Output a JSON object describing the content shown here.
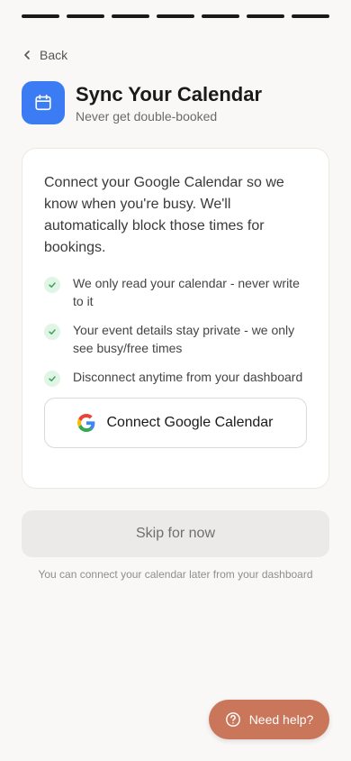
{
  "progress": {
    "total_steps": 7,
    "completed_steps": 7
  },
  "nav": {
    "back_label": "Back"
  },
  "header": {
    "title": "Sync Your Calendar",
    "subtitle": "Never get double-booked",
    "icon": "calendar-icon",
    "accent_color": "#3b7cf5"
  },
  "card": {
    "intro": "Connect your Google Calendar so we know when you're busy. We'll automatically block those times for bookings.",
    "bullets": [
      "We only read your calendar - never write to it",
      "Your event details stay private - we only see busy/free times",
      "Disconnect anytime from your dashboard"
    ],
    "connect_label": "Connect Google Calendar"
  },
  "skip": {
    "label": "Skip for now",
    "hint": "You can connect your calendar later from your dashboard"
  },
  "help": {
    "label": "Need help?",
    "color": "#c9765b"
  }
}
